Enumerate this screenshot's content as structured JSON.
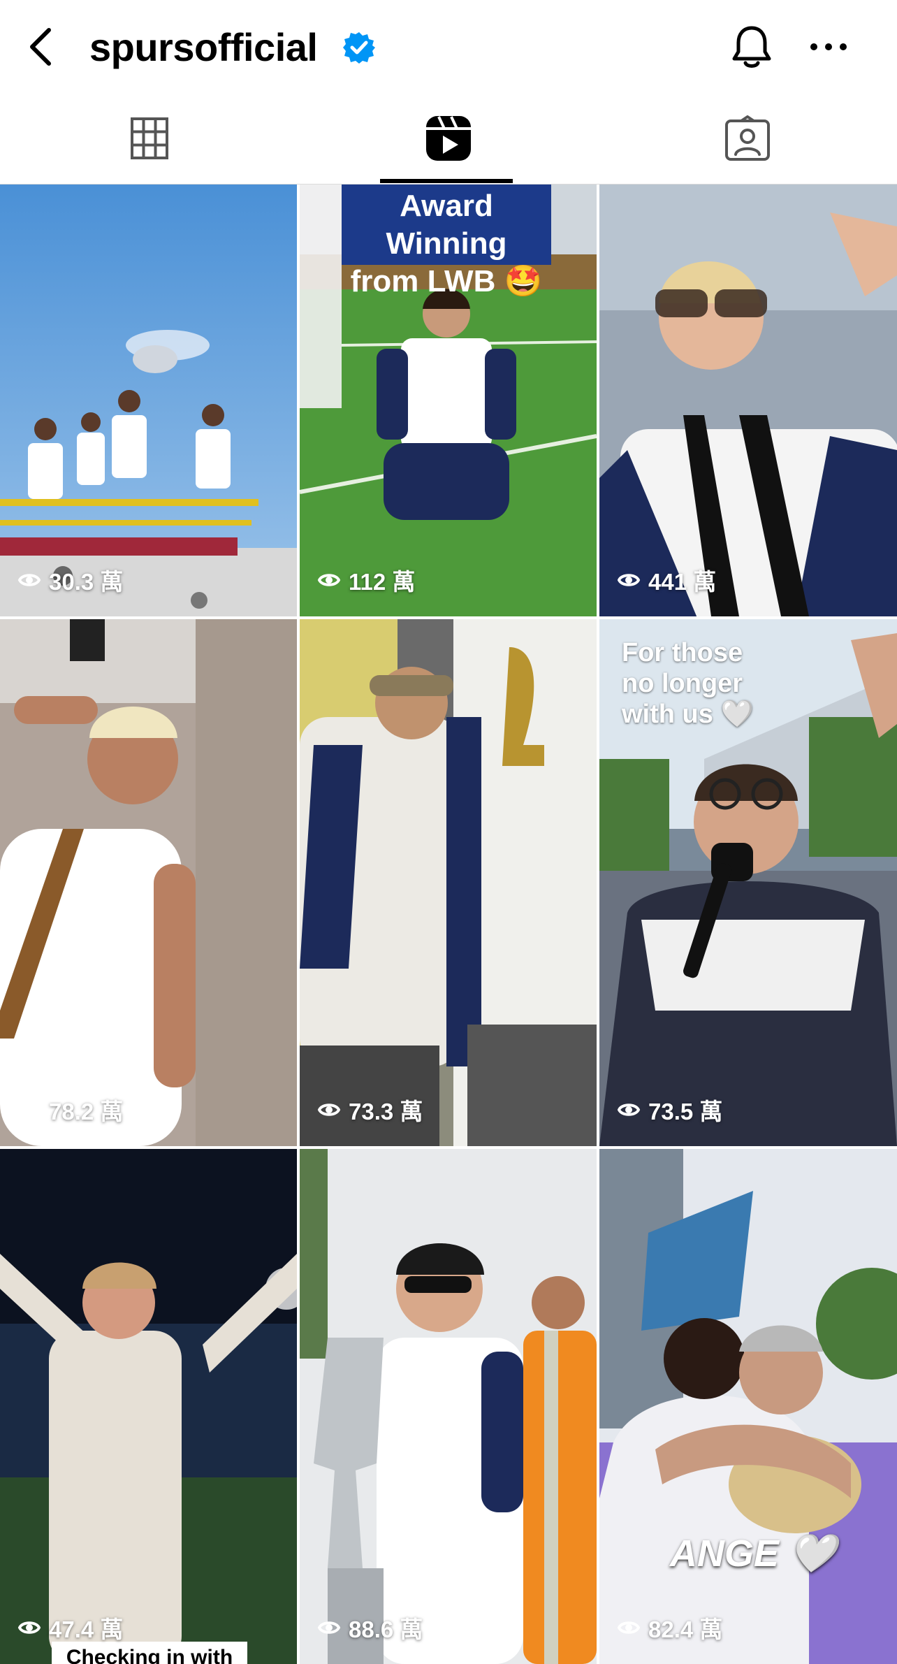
{
  "header": {
    "username": "spursofficial",
    "verified": true,
    "icons": [
      "back-arrow-icon",
      "verified-badge-icon",
      "bell-icon",
      "more-icon"
    ]
  },
  "tabs": [
    {
      "name": "grid",
      "icon": "grid-icon",
      "active": false
    },
    {
      "name": "reels",
      "icon": "reels-icon",
      "active": true
    },
    {
      "name": "tagged",
      "icon": "tagged-icon",
      "active": false
    }
  ],
  "reels": [
    {
      "views": "30.3 萬",
      "caption": ""
    },
    {
      "views": "112 萬",
      "caption": "Award Winning from LWB 🤩"
    },
    {
      "views": "441 萬",
      "caption": ""
    },
    {
      "views": "78.2 萬",
      "caption": ""
    },
    {
      "views": "73.3 萬",
      "caption": ""
    },
    {
      "views": "73.5 萬",
      "caption": "For those no longer with us 🤍"
    },
    {
      "views": "47.4 萬",
      "caption": "Checking in with Josh & Jamie! 🤝"
    },
    {
      "views": "88.6 萬",
      "caption": ""
    },
    {
      "views": "82.4 萬",
      "caption": "ANGE 🤍"
    }
  ],
  "colors": {
    "verified": "#0095f6",
    "text": "#000000",
    "spurs_navy": "#132257"
  }
}
